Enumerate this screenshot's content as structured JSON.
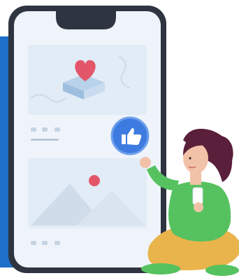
{
  "illustration": {
    "accent_blue": "#1E6FC8",
    "phone_frame": "#2E3440",
    "screen_bg": "#EEF4FA",
    "card_bg": "#E2ECF6",
    "heart_color": "#E3566A",
    "like_badge_color": "#3D7BE0",
    "sweater_color": "#55C25F",
    "pants_color": "#E9B44C",
    "hair_color": "#5A1F3A",
    "icons": [
      "heart-icon",
      "thumbs-up-icon",
      "image-placeholder-icon",
      "sun-icon"
    ]
  }
}
